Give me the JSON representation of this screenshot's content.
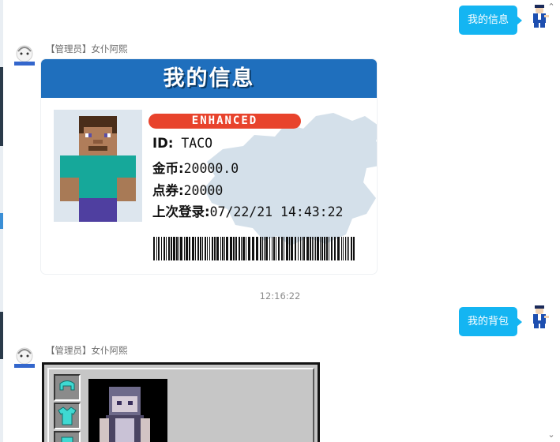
{
  "messages": {
    "out1": {
      "text": "我的信息"
    },
    "bot1": {
      "sender": "【管理员】女仆阿熙"
    },
    "card": {
      "title": "我的信息",
      "tag": "ENHANCED",
      "rows": [
        {
          "key": "ID:",
          "value": " TACO"
        },
        {
          "key": "金币:",
          "value": "20000.0"
        },
        {
          "key": "点券:",
          "value": "20000"
        },
        {
          "key": "上次登录:",
          "value": "07/22/21 14:43:22"
        }
      ]
    },
    "time": "12:16:22",
    "out2": {
      "text": "我的背包"
    },
    "bot2": {
      "sender": "【管理员】女仆阿熙"
    }
  },
  "colors": {
    "bubble": "#14b5f2",
    "card_header": "#1f6fbd",
    "tag": "#e8432c"
  },
  "icons": {
    "scroll_up": "chevron-up-icon",
    "scroll_down": "chevron-down-icon",
    "diamond_helmet": "diamond-helmet-icon",
    "diamond_chestplate": "diamond-chestplate-icon"
  }
}
